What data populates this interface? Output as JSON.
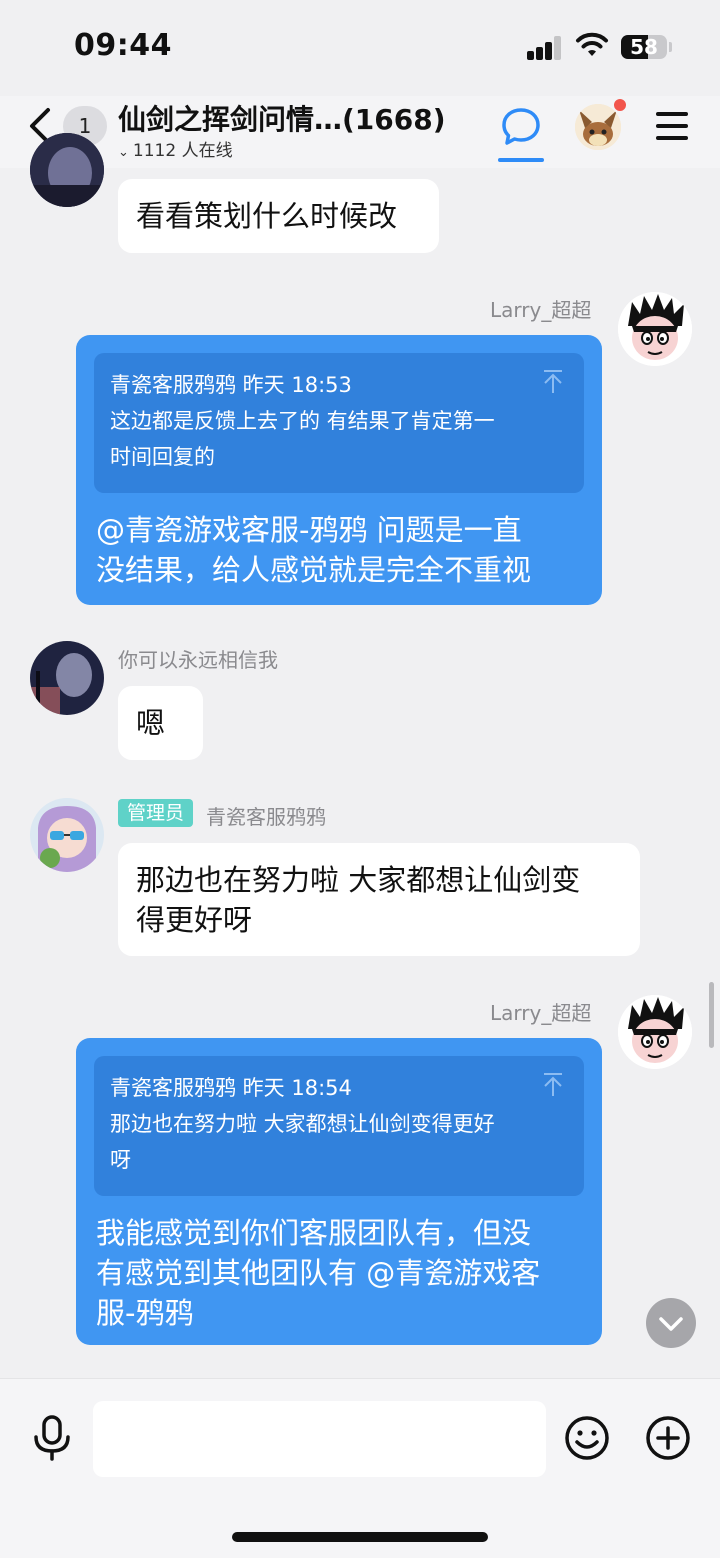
{
  "status_bar": {
    "time": "09:44",
    "battery_level": "58",
    "icons": [
      "signal-icon",
      "wifi-icon",
      "battery-icon"
    ]
  },
  "header": {
    "back_icon": "chevron-left-icon",
    "unread_count": "1",
    "group_title": "仙剑之挥剑问情…(1668)",
    "online_count": "1112 人在线",
    "chat_icon": "chat-bubble-icon",
    "menu_icon": "hamburger-menu-icon",
    "accent_color": "#2e8bf7",
    "notification_dot_color": "#f2554c"
  },
  "messages": [
    {
      "side": "left",
      "text": "看看策划什么时候改"
    },
    {
      "side": "right",
      "sender": "Larry_超超",
      "quote": {
        "author_time": "青瓷客服鸦鸦 昨天 18:53",
        "line1": "这边都是反馈上去了的 有结果了肯定第一",
        "line2": "时间回复的"
      },
      "line1": "@青瓷游戏客服-鸦鸦 问题是一直",
      "line2": "没结果，给人感觉就是完全不重视"
    },
    {
      "side": "left",
      "sender": "你可以永远相信我",
      "text": "嗯"
    },
    {
      "side": "left",
      "badge": "管理员",
      "sender": "青瓷客服鸦鸦",
      "line1": "那边也在努力啦 大家都想让仙剑变",
      "line2": "得更好呀"
    },
    {
      "side": "right",
      "sender": "Larry_超超",
      "quote": {
        "author_time": "青瓷客服鸦鸦 昨天 18:54",
        "line1": "那边也在努力啦 大家都想让仙剑变得更好",
        "line2": "呀"
      },
      "line1": "我能感觉到你们客服团队有，但没",
      "line2": "有感觉到其他团队有 @青瓷游戏客",
      "line3": "服-鸦鸦"
    }
  ],
  "colors": {
    "blue_bubble": "#4096f2",
    "quote_block": "#3181dc",
    "admin_badge": "#5fd2c8",
    "background": "#f0f0f2"
  },
  "input_bar": {
    "value": "",
    "icons": [
      "microphone-icon",
      "emoji-icon",
      "plus-circle-icon"
    ]
  }
}
